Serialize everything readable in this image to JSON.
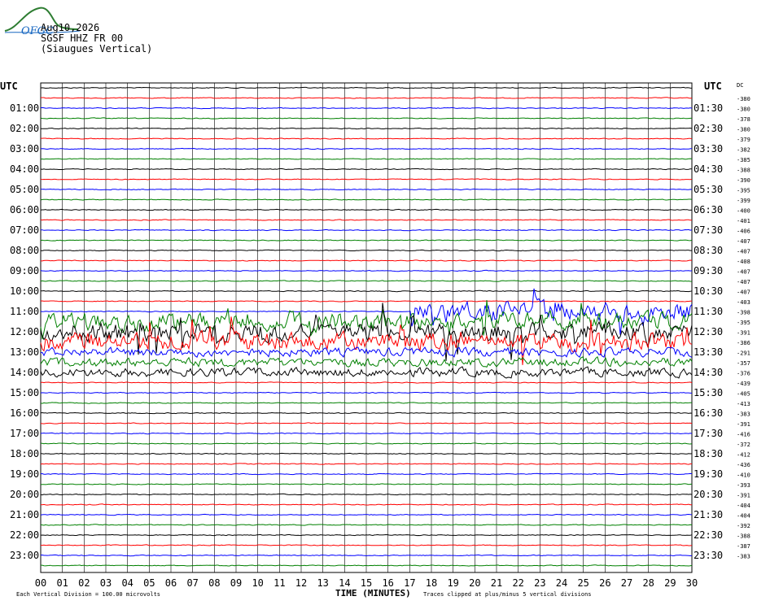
{
  "logo": {
    "text": "OFGC",
    "color": "#2e7d32",
    "accent": "#1565c0"
  },
  "header": {
    "date": "Aug10,2026",
    "station": "SGSF HHZ FR 00",
    "location": "(Siaugues Vertical)"
  },
  "footer": {
    "scale_note": "Each Vertical Division =  100.00 microvolts",
    "xlabel": "TIME (MINUTES)",
    "clip_note": "Traces clipped at plus/minus 5 vertical divisions"
  },
  "colors": {
    "trace_cycle": [
      "#000000",
      "#ff0000",
      "#0000ff",
      "#008000"
    ],
    "grid": "#000000"
  },
  "chart_data": {
    "type": "line",
    "subtype": "helicorder",
    "left_axis_title": "UTC",
    "right_axis_title": "UTC",
    "dc_label": "DC",
    "left_labels": [
      "01:00",
      "02:00",
      "03:00",
      "04:00",
      "05:00",
      "06:00",
      "07:00",
      "08:00",
      "09:00",
      "10:00",
      "11:00",
      "12:00",
      "13:00",
      "14:00",
      "15:00",
      "16:00",
      "17:00",
      "18:00",
      "19:00",
      "20:00",
      "21:00",
      "22:00",
      "23:00"
    ],
    "right_labels": [
      "01:30",
      "02:30",
      "03:30",
      "04:30",
      "05:30",
      "06:30",
      "07:30",
      "08:30",
      "09:30",
      "10:30",
      "11:30",
      "12:30",
      "13:30",
      "14:30",
      "15:30",
      "16:30",
      "17:30",
      "18:30",
      "19:30",
      "20:30",
      "21:30",
      "22:30",
      "23:30"
    ],
    "x_ticks": [
      "00",
      "01",
      "02",
      "03",
      "04",
      "05",
      "06",
      "07",
      "08",
      "09",
      "10",
      "11",
      "12",
      "13",
      "14",
      "15",
      "16",
      "17",
      "18",
      "19",
      "20",
      "21",
      "22",
      "23",
      "24",
      "25",
      "26",
      "27",
      "28",
      "29",
      "30"
    ],
    "xlim": [
      0,
      30
    ],
    "rows": 48,
    "minutes_per_row": 30,
    "dc_offsets": [
      -380,
      -380,
      -378,
      -380,
      -379,
      -382,
      -385,
      -388,
      -390,
      -395,
      -399,
      -400,
      -401,
      -406,
      -407,
      -407,
      -408,
      -407,
      -407,
      -407,
      -403,
      -398,
      -395,
      -391,
      -386,
      -291,
      -357,
      -376,
      -439,
      -405,
      -413,
      -383,
      -391,
      -416,
      -372,
      -412,
      -436,
      -410,
      -393,
      -391,
      -404,
      -404,
      -392,
      -388,
      -387,
      -383
    ],
    "activity": {
      "description_ranges": [
        {
          "rows": [
            22,
            22
          ],
          "from_min": 17.0,
          "to_min": 30.0,
          "level": "high"
        },
        {
          "rows": [
            23,
            25
          ],
          "from_min": 0.0,
          "to_min": 30.0,
          "level": "high"
        },
        {
          "rows": [
            26,
            28
          ],
          "from_min": 0.0,
          "to_min": 30.0,
          "level": "moderate"
        }
      ]
    }
  }
}
